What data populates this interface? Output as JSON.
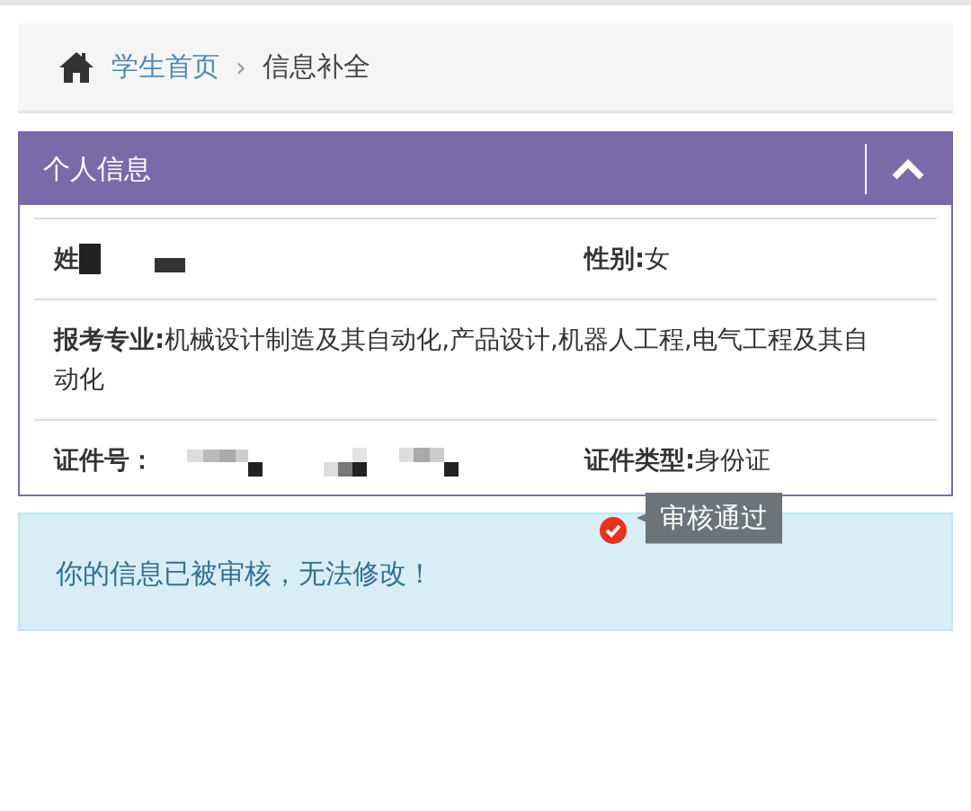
{
  "breadcrumb": {
    "items": [
      {
        "label": "学生首页",
        "kind": "link"
      },
      {
        "label": "信息补全",
        "kind": "current"
      }
    ],
    "separator": "›"
  },
  "panel": {
    "title": "个人信息",
    "expanded": true,
    "rows": [
      {
        "fields": [
          {
            "label": "姓",
            "kind": "redacted"
          },
          {
            "label": "性别:",
            "value": "女",
            "kind": "text"
          }
        ]
      },
      {
        "fields": [
          {
            "label": "报考专业:",
            "value": "机械设计制造及其自动化,产品设计,机器人工程,电气工程及其自动化",
            "kind": "text"
          }
        ]
      },
      {
        "fields": [
          {
            "label": "证件号：",
            "kind": "pixelated"
          },
          {
            "label": "证件类型:",
            "value": "身份证",
            "kind": "text"
          }
        ]
      }
    ]
  },
  "alert": {
    "text": "你的信息已被审核，无法修改！"
  },
  "status_tip": {
    "text": "审核通过"
  }
}
